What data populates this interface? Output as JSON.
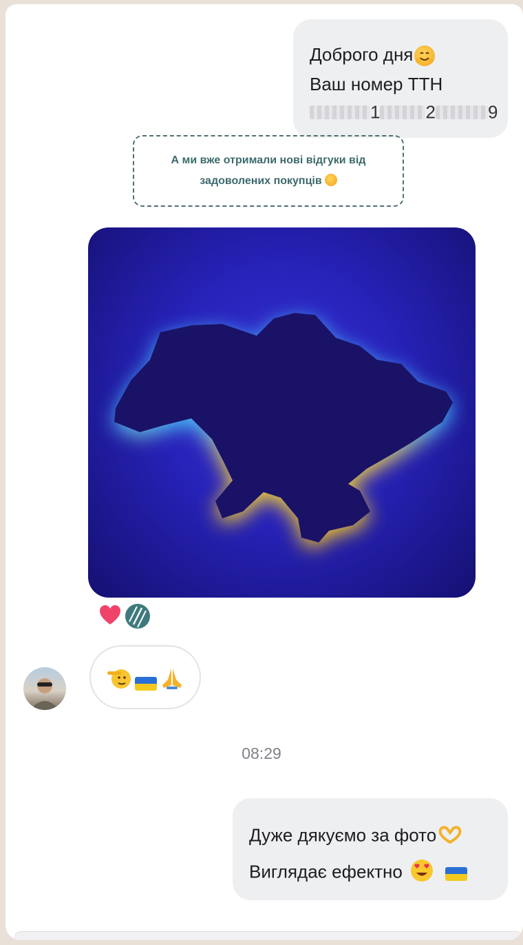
{
  "messages": {
    "first_out": {
      "line1": "Доброго дня",
      "line2": "Ваш номер ТТН",
      "ttn_visible_digit_1": "1",
      "ttn_visible_digit_2": "2",
      "ttn_visible_digit_3": "9"
    },
    "note": {
      "line1": "А ми вже отримали нові відгуки від",
      "line2": "задоволених покупців"
    },
    "incoming_emojis": [
      "🫡",
      "🇺🇦",
      "🙏"
    ],
    "time": "08:29",
    "second_out": {
      "line1": "Дуже дякуємо за фото",
      "line2": "Виглядає ефектно"
    }
  },
  "icons": {
    "first_out_emoji": "hugging-face-icon",
    "note_emoji": "star-struck-face-icon",
    "heart_reaction": "heart-icon",
    "logo_reaction": "brand-logo-icon",
    "thanks_emoji": "heart-hands-icon",
    "love_emoji": "heart-eyes-face-icon",
    "flag_emoji": "ukraine-flag-icon"
  },
  "colors": {
    "bubble_out": "#eeeff1",
    "note_border": "#4f6f72",
    "note_text": "#3d6a6d",
    "photo_background": "#2722b8",
    "map_glow_blue": "#3fb7ff",
    "map_glow_yellow": "#ffd21f",
    "heart": "#f0436a",
    "time_text": "#808088"
  }
}
